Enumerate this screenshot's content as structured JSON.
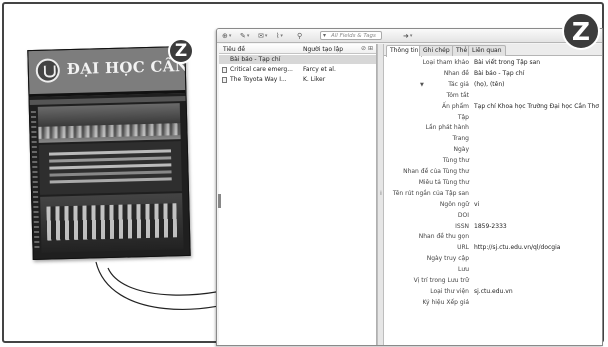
{
  "cover": {
    "title": "ĐẠI HỌC CẦN THƠ"
  },
  "badges": {
    "small": "Z",
    "large": "Z"
  },
  "toolbar": {
    "search_placeholder": "All Fields & Tags"
  },
  "items": {
    "header_title": "Tiêu đề",
    "header_creator": "Người tạo lập",
    "rows": [
      {
        "title": "Bài báo - Tạp chí",
        "creator": ""
      },
      {
        "title": "Critical care emerg...",
        "creator": "Farcy et al."
      },
      {
        "title": "The Toyota Way I...",
        "creator": "K. Liker"
      }
    ]
  },
  "tabs": [
    "Thông tin",
    "Ghi chép",
    "Thẻ",
    "Liên quan"
  ],
  "fields": [
    {
      "label": "Loại tham khảo",
      "value": "Bài viết trong Tập san"
    },
    {
      "label": "Nhan đề",
      "value": "Bài báo - Tạp chí"
    },
    {
      "label": "Tác giả",
      "value": "(họ), (tên)"
    },
    {
      "label": "Tóm tắt",
      "value": ""
    },
    {
      "label": "Ấn phẩm",
      "value": "Tạp chí Khoa học Trường Đại học Cần Thơ"
    },
    {
      "label": "Tập",
      "value": ""
    },
    {
      "label": "Lần phát hành",
      "value": ""
    },
    {
      "label": "Trang",
      "value": ""
    },
    {
      "label": "Ngày",
      "value": ""
    },
    {
      "label": "Tùng thư",
      "value": ""
    },
    {
      "label": "Nhan đề của Tùng thư",
      "value": ""
    },
    {
      "label": "Miêu tả Tùng thư",
      "value": ""
    },
    {
      "label": "Tên rút ngắn của Tập san",
      "value": ""
    },
    {
      "label": "Ngôn ngữ",
      "value": "vi"
    },
    {
      "label": "DOI",
      "value": ""
    },
    {
      "label": "ISSN",
      "value": "1859-2333"
    },
    {
      "label": "Nhan đề thu gọn",
      "value": ""
    },
    {
      "label": "URL",
      "value": "http://sj.ctu.edu.vn/ql/docgia"
    },
    {
      "label": "Ngày truy cập",
      "value": ""
    },
    {
      "label": "Lưu",
      "value": ""
    },
    {
      "label": "Vị trí trong Lưu trữ",
      "value": ""
    },
    {
      "label": "Loại thư viện",
      "value": "sj.ctu.edu.vn"
    },
    {
      "label": "Ký hiệu Xếp giá",
      "value": ""
    }
  ]
}
